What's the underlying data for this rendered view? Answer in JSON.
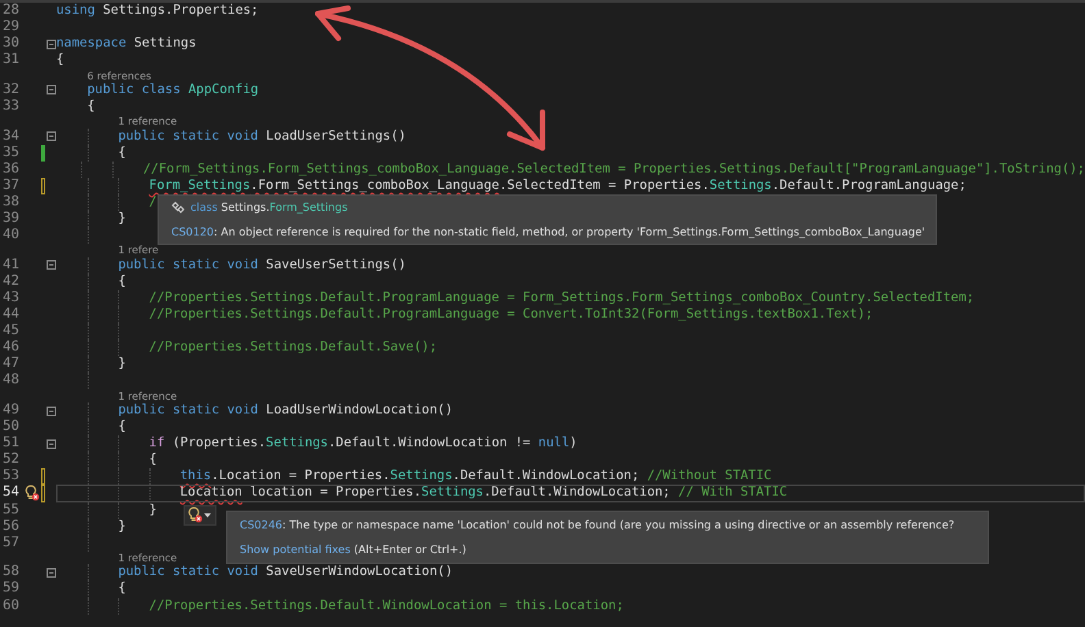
{
  "editor": {
    "lines": [
      {
        "number": "28",
        "tokens": [
          {
            "kind": "keyword",
            "text": "using"
          },
          {
            "kind": "plain",
            "text": " Settings.Properties;"
          }
        ]
      },
      {
        "number": "29"
      },
      {
        "number": "30",
        "foldable": true,
        "tokens": [
          {
            "kind": "keyword",
            "text": "namespace"
          },
          {
            "kind": "plain",
            "text": " Settings"
          }
        ]
      },
      {
        "number": "31",
        "tokens": [
          {
            "kind": "plain",
            "text": "{"
          }
        ],
        "children": [
          {
            "number": "32",
            "codelens": "6 references",
            "foldable": true,
            "tokens": [
              {
                "kind": "keyword",
                "text": "public class "
              },
              {
                "kind": "type",
                "text": "AppConfig"
              }
            ]
          },
          {
            "number": "33",
            "tokens": [
              {
                "kind": "plain",
                "text": "{"
              }
            ],
            "children": [
              {
                "number": "34",
                "codelens": "1 reference",
                "foldable": true,
                "tokens": [
                  {
                    "kind": "keyword",
                    "text": "public static void "
                  },
                  {
                    "kind": "method",
                    "text": "LoadUserSettings()"
                  }
                ]
              },
              {
                "number": "35",
                "saved_change": true,
                "tokens": [
                  {
                    "kind": "plain",
                    "text": "{"
                  }
                ],
                "children": [
                  {
                    "number": "36",
                    "tokens": [
                      {
                        "kind": "comment",
                        "text": "//Form_Settings.Form_Settings_comboBox_Language.SelectedItem = Properties.Settings.Default[\"ProgramLanguage\"].ToString();"
                      }
                    ]
                  },
                  {
                    "number": "37",
                    "unsaved_change": true,
                    "tokens": [
                      {
                        "kind": "type",
                        "text": "Form_Settings",
                        "error": true
                      },
                      {
                        "kind": "plain",
                        "text": ".Form_Settings_comboBox_Language",
                        "error": true
                      },
                      {
                        "kind": "plain",
                        "text": ".SelectedItem = Properties."
                      },
                      {
                        "kind": "type",
                        "text": "Settings"
                      },
                      {
                        "kind": "plain",
                        "text": ".Default.ProgramLanguage;"
                      }
                    ],
                    "popup": {
                      "kind": "info",
                      "signature": [
                        {
                          "kind": "keyword",
                          "text": "class "
                        },
                        {
                          "kind": "plain",
                          "text": "Settings."
                        },
                        {
                          "kind": "type",
                          "text": "Form_Settings"
                        }
                      ],
                      "code": "CS0120",
                      "message": ": An object reference is required for the non-static field, method, or property 'Form_Settings.Form_Settings_comboBox_Language'"
                    }
                  },
                  {
                    "number": "38",
                    "tokens": [
                      {
                        "kind": "comment",
                        "text": "/"
                      }
                    ]
                  }
                ]
              },
              {
                "number": "39",
                "tokens": [
                  {
                    "kind": "plain",
                    "text": "}"
                  }
                ]
              },
              {
                "number": "40"
              },
              {
                "number": "41",
                "codelens": "1 refere",
                "foldable": true,
                "tokens": [
                  {
                    "kind": "keyword",
                    "text": "public static void "
                  },
                  {
                    "kind": "method",
                    "text": "SaveUserSettings()"
                  }
                ]
              },
              {
                "number": "42",
                "tokens": [
                  {
                    "kind": "plain",
                    "text": "{"
                  }
                ],
                "children": [
                  {
                    "number": "43",
                    "tokens": [
                      {
                        "kind": "comment",
                        "text": "//Properties.Settings.Default.ProgramLanguage = Form_Settings.Form_Settings_comboBox_Country.SelectedItem;"
                      }
                    ]
                  },
                  {
                    "number": "44",
                    "tokens": [
                      {
                        "kind": "comment",
                        "text": "//Properties.Settings.Default.ProgramLanguage = Convert.ToInt32(Form_Settings.textBox1.Text);"
                      }
                    ]
                  },
                  {
                    "number": "45"
                  },
                  {
                    "number": "46",
                    "tokens": [
                      {
                        "kind": "comment",
                        "text": "//Properties.Settings.Default.Save();"
                      }
                    ]
                  }
                ]
              },
              {
                "number": "47",
                "tokens": [
                  {
                    "kind": "plain",
                    "text": "}"
                  }
                ]
              },
              {
                "number": "48"
              },
              {
                "number": "49",
                "codelens": "1 reference",
                "foldable": true,
                "tokens": [
                  {
                    "kind": "keyword",
                    "text": "public static void "
                  },
                  {
                    "kind": "method",
                    "text": "LoadUserWindowLocation()"
                  }
                ]
              },
              {
                "number": "50",
                "tokens": [
                  {
                    "kind": "plain",
                    "text": "{"
                  }
                ],
                "children": [
                  {
                    "number": "51",
                    "foldable": true,
                    "tokens": [
                      {
                        "kind": "control",
                        "text": "if"
                      },
                      {
                        "kind": "plain",
                        "text": " (Properties."
                      },
                      {
                        "kind": "type",
                        "text": "Settings"
                      },
                      {
                        "kind": "plain",
                        "text": ".Default.WindowLocation != "
                      },
                      {
                        "kind": "keyword",
                        "text": "null"
                      },
                      {
                        "kind": "plain",
                        "text": ")"
                      }
                    ]
                  },
                  {
                    "number": "52",
                    "tokens": [
                      {
                        "kind": "plain",
                        "text": "{"
                      }
                    ],
                    "children": [
                      {
                        "number": "53",
                        "unsaved_change": true,
                        "tokens": [
                          {
                            "kind": "keyword",
                            "text": "this",
                            "error": true
                          },
                          {
                            "kind": "plain",
                            "text": ".Location = Properties."
                          },
                          {
                            "kind": "type",
                            "text": "Settings"
                          },
                          {
                            "kind": "plain",
                            "text": ".Default.WindowLocation; "
                          },
                          {
                            "kind": "comment",
                            "text": "//Without STATIC"
                          }
                        ]
                      },
                      {
                        "number": "54",
                        "unsaved_change": true,
                        "current": true,
                        "lightbulb": true,
                        "tokens": [
                          {
                            "kind": "plain",
                            "text": "Location",
                            "error": true
                          },
                          {
                            "kind": "plain",
                            "text": " location = Properties."
                          },
                          {
                            "kind": "type",
                            "text": "Settings"
                          },
                          {
                            "kind": "plain",
                            "text": ".Default.WindowLocation; "
                          },
                          {
                            "kind": "comment",
                            "text": "// With STATIC"
                          }
                        ],
                        "popup": {
                          "kind": "error",
                          "code": "CS0246",
                          "message": ": The type or namespace name 'Location' could not be found (are you missing a using directive or an assembly reference?",
                          "fix_link": "Show potential fixes",
                          "fix_hint": " (Alt+Enter or Ctrl+.)"
                        }
                      }
                    ]
                  },
                  {
                    "number": "55",
                    "tokens": [
                      {
                        "kind": "plain",
                        "text": "}"
                      }
                    ]
                  }
                ]
              },
              {
                "number": "56",
                "tokens": [
                  {
                    "kind": "plain",
                    "text": "}"
                  }
                ]
              },
              {
                "number": "57"
              },
              {
                "number": "58",
                "codelens": "1 reference",
                "foldable": true,
                "tokens": [
                  {
                    "kind": "keyword",
                    "text": "public static void "
                  },
                  {
                    "kind": "method",
                    "text": "SaveUserWindowLocation()"
                  }
                ]
              },
              {
                "number": "59",
                "tokens": [
                  {
                    "kind": "plain",
                    "text": "{"
                  }
                ],
                "children": [
                  {
                    "number": "60",
                    "tokens": [
                      {
                        "kind": "comment",
                        "text": "//Properties.Settings.Default.WindowLocation = this.Location;"
                      }
                    ]
                  }
                ]
              }
            ]
          }
        ]
      }
    ]
  }
}
